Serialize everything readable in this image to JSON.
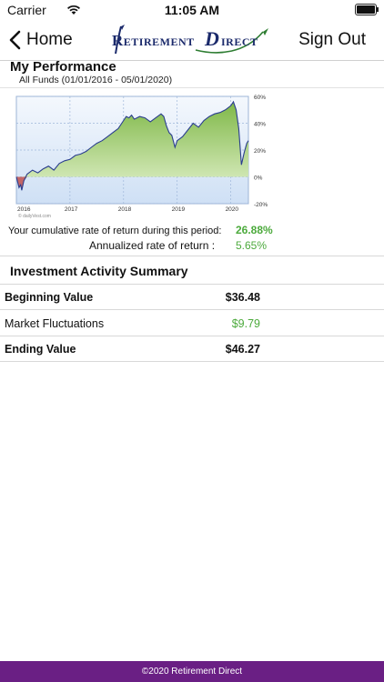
{
  "status_bar": {
    "carrier": "Carrier",
    "time": "11:05 AM"
  },
  "nav": {
    "back_label": "Home",
    "signout_label": "Sign Out",
    "logo_text_1": "Retirement",
    "logo_text_2": "irect",
    "logo_initial": "D"
  },
  "performance": {
    "title": "My Performance",
    "subtitle": "All Funds (01/01/2016 - 05/01/2020)",
    "cumulative_label": "Your cumulative rate of return during this period:",
    "cumulative_value": "26.88%",
    "annualized_label": "Annualized rate of return :",
    "annualized_value": "5.65%"
  },
  "chart_data": {
    "type": "area",
    "x_tick_labels": [
      "2016",
      "2017",
      "2018",
      "2019",
      "2020"
    ],
    "y_tick_labels": [
      "60%",
      "40%",
      "20%",
      "0%",
      "-20%"
    ],
    "watermark": "© dailyVest.com",
    "ylim": [
      -20,
      60
    ],
    "grid": true,
    "series": [
      {
        "values": [
          [
            2016.0,
            0
          ],
          [
            2016.05,
            -8
          ],
          [
            2016.08,
            -6
          ],
          [
            2016.1,
            -10
          ],
          [
            2016.14,
            -3
          ],
          [
            2016.2,
            2
          ],
          [
            2016.3,
            5
          ],
          [
            2016.4,
            3
          ],
          [
            2016.5,
            6
          ],
          [
            2016.6,
            8
          ],
          [
            2016.7,
            5
          ],
          [
            2016.8,
            10
          ],
          [
            2016.9,
            12
          ],
          [
            2017.0,
            13
          ],
          [
            2017.1,
            16
          ],
          [
            2017.2,
            17
          ],
          [
            2017.3,
            19
          ],
          [
            2017.4,
            22
          ],
          [
            2017.5,
            25
          ],
          [
            2017.6,
            27
          ],
          [
            2017.7,
            30
          ],
          [
            2017.8,
            33
          ],
          [
            2017.9,
            36
          ],
          [
            2018.0,
            42
          ],
          [
            2018.05,
            45
          ],
          [
            2018.1,
            44
          ],
          [
            2018.15,
            46
          ],
          [
            2018.2,
            43
          ],
          [
            2018.3,
            45
          ],
          [
            2018.4,
            44
          ],
          [
            2018.5,
            41
          ],
          [
            2018.6,
            44
          ],
          [
            2018.7,
            47
          ],
          [
            2018.75,
            45
          ],
          [
            2018.8,
            38
          ],
          [
            2018.85,
            33
          ],
          [
            2018.9,
            31
          ],
          [
            2018.96,
            22
          ],
          [
            2019.0,
            27
          ],
          [
            2019.1,
            30
          ],
          [
            2019.2,
            35
          ],
          [
            2019.3,
            40
          ],
          [
            2019.4,
            37
          ],
          [
            2019.5,
            42
          ],
          [
            2019.6,
            45
          ],
          [
            2019.7,
            47
          ],
          [
            2019.8,
            48
          ],
          [
            2019.9,
            50
          ],
          [
            2020.0,
            53
          ],
          [
            2020.05,
            56
          ],
          [
            2020.1,
            50
          ],
          [
            2020.15,
            36
          ],
          [
            2020.2,
            9
          ],
          [
            2020.25,
            18
          ],
          [
            2020.3,
            25
          ],
          [
            2020.33,
            27
          ]
        ]
      }
    ]
  },
  "summary": {
    "title": "Investment Activity Summary",
    "rows": [
      {
        "label": "Beginning Value",
        "value": "$36.48"
      },
      {
        "label": "Market Fluctuations",
        "value": "$9.79"
      },
      {
        "label": "Ending Value",
        "value": "$46.27"
      }
    ]
  },
  "footer": {
    "text": "©2020 Retirement Direct"
  },
  "colors": {
    "footer_bg": "#6a1f84",
    "positive": "#4caa3c",
    "area_top": "#7fb848",
    "area_bottom": "#cfe6b2",
    "negative": "#c0504d"
  }
}
